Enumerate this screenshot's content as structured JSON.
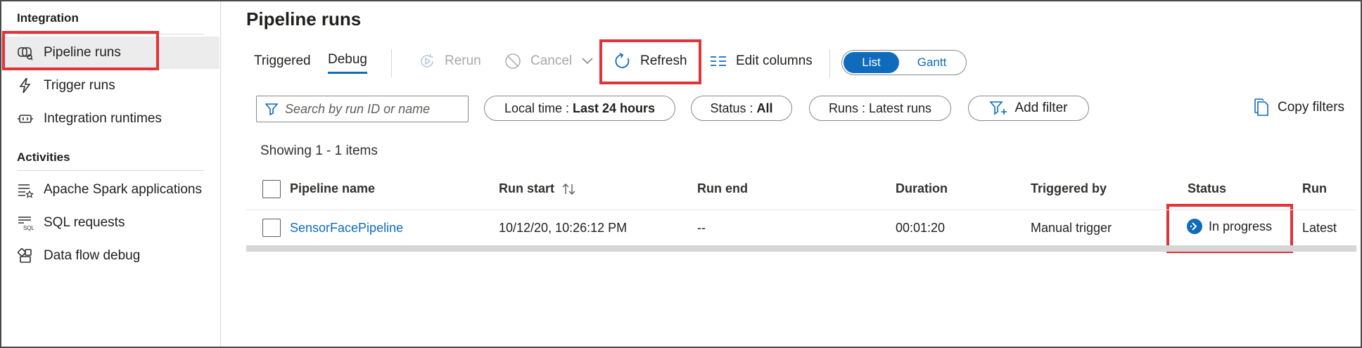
{
  "sidebar": {
    "section_integration": "Integration",
    "section_activities": "Activities",
    "items": [
      {
        "label": "Pipeline runs",
        "icon": "pipeline-runs-icon"
      },
      {
        "label": "Trigger runs",
        "icon": "lightning-icon"
      },
      {
        "label": "Integration runtimes",
        "icon": "integration-runtime-icon"
      },
      {
        "label": "Apache Spark applications",
        "icon": "spark-list-icon"
      },
      {
        "label": "SQL requests",
        "icon": "sql-list-icon"
      },
      {
        "label": "Data flow debug",
        "icon": "data-flow-icon"
      }
    ]
  },
  "page": {
    "title": "Pipeline runs"
  },
  "toolbar": {
    "tab_triggered": "Triggered",
    "tab_debug": "Debug",
    "rerun": "Rerun",
    "cancel": "Cancel",
    "refresh": "Refresh",
    "edit_columns": "Edit columns",
    "view_list": "List",
    "view_gantt": "Gantt"
  },
  "filters": {
    "search_placeholder": "Search by run ID or name",
    "time_label": "Local time : ",
    "time_value": "Last 24 hours",
    "status_label": "Status : ",
    "status_value": "All",
    "runs_label": "Runs : ",
    "runs_value": "Latest runs",
    "add_filter": "Add filter",
    "copy_filters": "Copy filters"
  },
  "showing": "Showing 1 - 1 items",
  "table": {
    "headers": {
      "pipeline_name": "Pipeline name",
      "run_start": "Run start",
      "run_end": "Run end",
      "duration": "Duration",
      "triggered_by": "Triggered by",
      "status": "Status",
      "run": "Run"
    },
    "rows": [
      {
        "pipeline_name": "SensorFacePipeline",
        "run_start": "10/12/20, 10:26:12 PM",
        "run_end": "--",
        "duration": "00:01:20",
        "triggered_by": "Manual trigger",
        "status": "In progress",
        "run": "Latest"
      }
    ]
  },
  "colors": {
    "accent": "#0f6cbd",
    "highlight_box": "#e0343a"
  }
}
